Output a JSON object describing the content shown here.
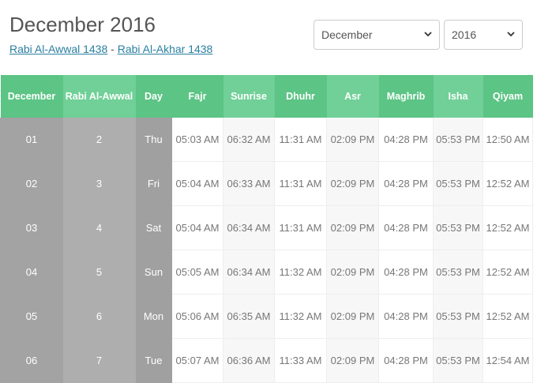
{
  "header": {
    "title": "December 2016",
    "hijri_month_1": "Rabi Al-Awwal 1438",
    "separator": " - ",
    "hijri_month_2": "Rabi Al-Akhar 1438"
  },
  "selectors": {
    "month": "December",
    "year": "2016"
  },
  "table": {
    "headers": [
      "December",
      "Rabi Al-Awwal",
      "Day",
      "Fajr",
      "Sunrise",
      "Dhuhr",
      "Asr",
      "Maghrib",
      "Isha",
      "Qiyam"
    ],
    "rows": [
      [
        "01",
        "2",
        "Thu",
        "05:03 AM",
        "06:32 AM",
        "11:31 AM",
        "02:09 PM",
        "04:28 PM",
        "05:53 PM",
        "12:50 AM"
      ],
      [
        "02",
        "3",
        "Fri",
        "05:04 AM",
        "06:33 AM",
        "11:31 AM",
        "02:09 PM",
        "04:28 PM",
        "05:53 PM",
        "12:52 AM"
      ],
      [
        "03",
        "4",
        "Sat",
        "05:04 AM",
        "06:34 AM",
        "11:31 AM",
        "02:09 PM",
        "04:28 PM",
        "05:53 PM",
        "12:52 AM"
      ],
      [
        "04",
        "5",
        "Sun",
        "05:05 AM",
        "06:34 AM",
        "11:32 AM",
        "02:09 PM",
        "04:28 PM",
        "05:53 PM",
        "12:52 AM"
      ],
      [
        "05",
        "6",
        "Mon",
        "05:06 AM",
        "06:35 AM",
        "11:32 AM",
        "02:09 PM",
        "04:28 PM",
        "05:53 PM",
        "12:52 AM"
      ],
      [
        "06",
        "7",
        "Tue",
        "05:07 AM",
        "06:36 AM",
        "11:33 AM",
        "02:09 PM",
        "04:28 PM",
        "05:53 PM",
        "12:54 AM"
      ]
    ]
  },
  "colors": {
    "header_green": "#5cc485",
    "header_green_light": "#70d097",
    "date_column_gray": "#a3a3a3",
    "link_blue": "#2a7fa0"
  },
  "icons": {
    "dropdown": "chevron-down-icon"
  }
}
